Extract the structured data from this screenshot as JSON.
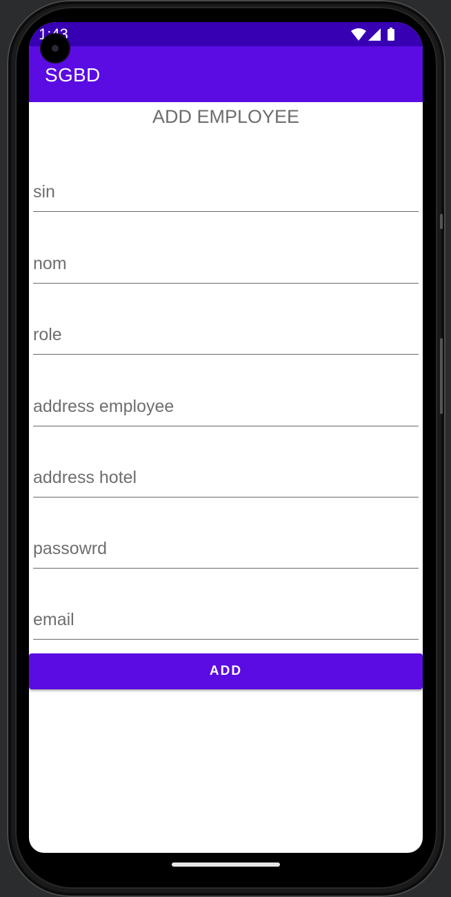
{
  "status_bar": {
    "time": "1:43",
    "icons": [
      "wifi-icon",
      "cell-signal-icon",
      "battery-icon"
    ]
  },
  "app_bar": {
    "title": "SGBD"
  },
  "page": {
    "heading": "ADD EMPLOYEE"
  },
  "form": {
    "fields": [
      {
        "placeholder": "sin",
        "value": ""
      },
      {
        "placeholder": "nom",
        "value": ""
      },
      {
        "placeholder": "role",
        "value": ""
      },
      {
        "placeholder": "address employee",
        "value": ""
      },
      {
        "placeholder": "address hotel",
        "value": ""
      },
      {
        "placeholder": "passowrd",
        "value": ""
      },
      {
        "placeholder": "email",
        "value": ""
      }
    ],
    "submit_label": "ADD"
  },
  "colors": {
    "status_bar": "#3700b3",
    "primary": "#5a0ce2",
    "text_secondary": "#6b6b6b"
  }
}
